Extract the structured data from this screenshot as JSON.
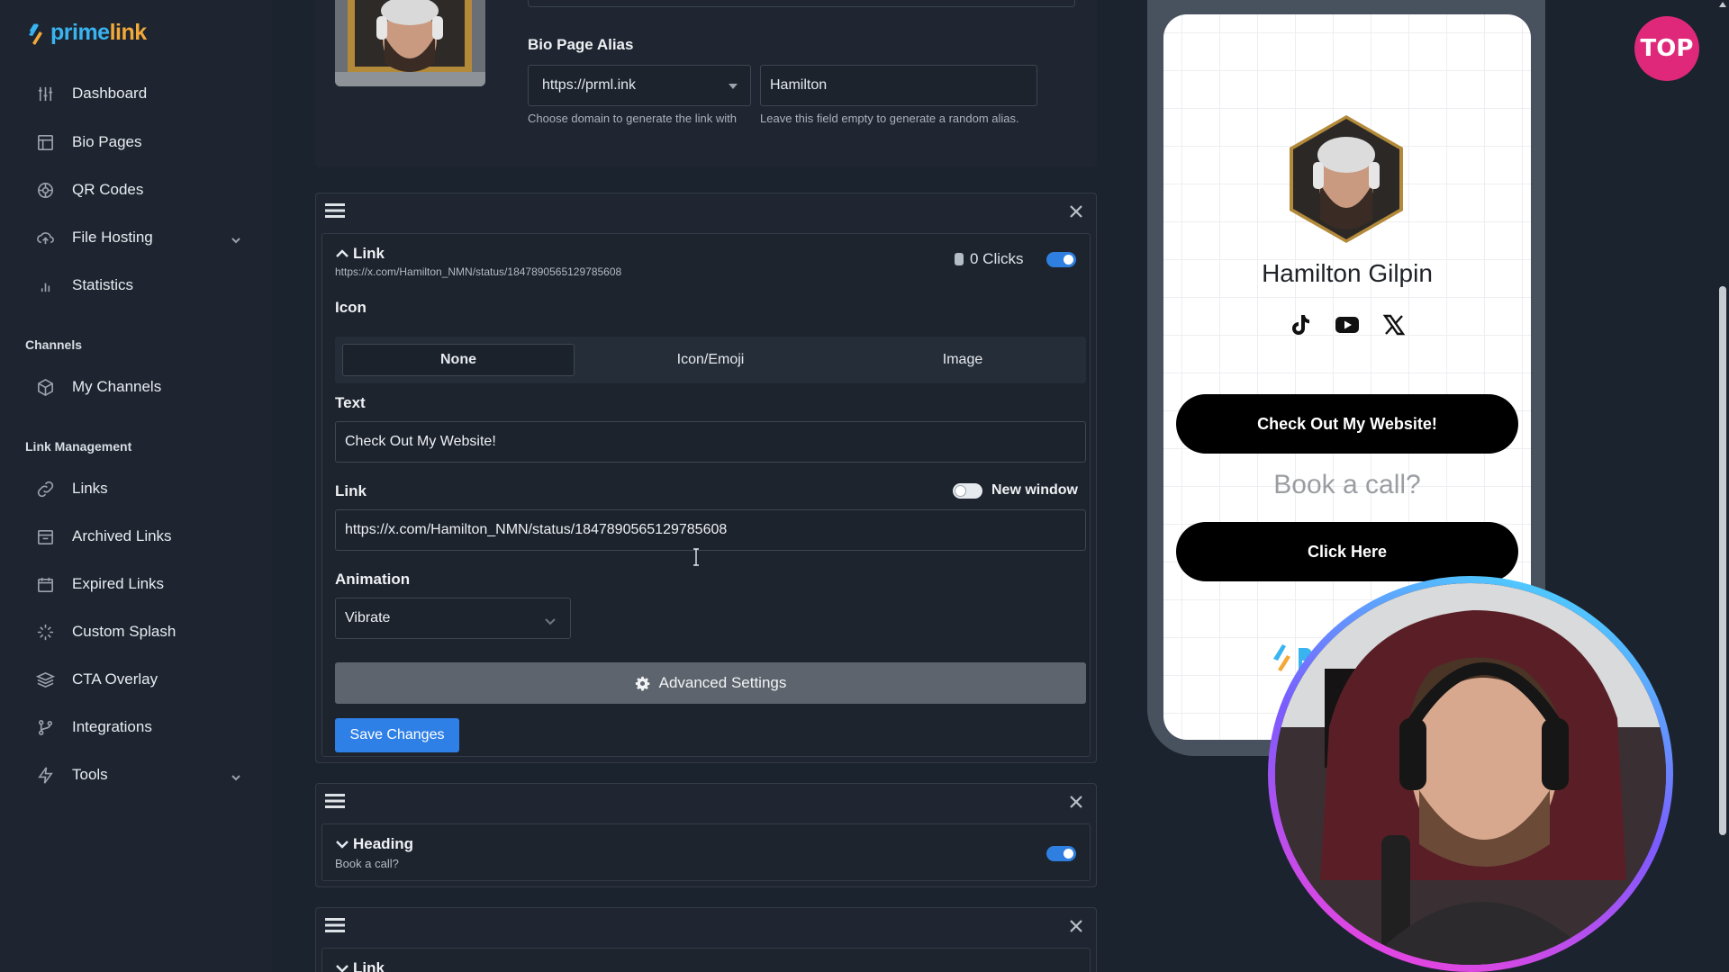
{
  "brand": {
    "part1": "prime",
    "part2": "link"
  },
  "sidebar": {
    "items": [
      {
        "label": "Dashboard",
        "icon": "dashboard-icon"
      },
      {
        "label": "Bio Pages",
        "icon": "bio-pages-icon"
      },
      {
        "label": "QR Codes",
        "icon": "qr-codes-icon"
      },
      {
        "label": "File Hosting",
        "icon": "file-hosting-icon"
      },
      {
        "label": "Statistics",
        "icon": "statistics-icon"
      }
    ],
    "channels_label": "Channels",
    "channels": [
      {
        "label": "My Channels",
        "icon": "cube-icon"
      }
    ],
    "link_mgmt_label": "Link Management",
    "link_mgmt": [
      {
        "label": "Links",
        "icon": "link-icon"
      },
      {
        "label": "Archived Links",
        "icon": "archive-icon"
      },
      {
        "label": "Expired Links",
        "icon": "calendar-icon"
      },
      {
        "label": "Custom Splash",
        "icon": "splash-icon"
      },
      {
        "label": "CTA Overlay",
        "icon": "layers-icon"
      },
      {
        "label": "Integrations",
        "icon": "integrations-icon"
      },
      {
        "label": "Tools",
        "icon": "bolt-icon"
      }
    ]
  },
  "alias": {
    "label": "Bio Page Alias",
    "domain_value": "https://prml.ink",
    "domain_hint": "Choose domain to generate the link with",
    "alias_value": "Hamilton",
    "alias_hint": "Leave this field empty to generate a random alias."
  },
  "link_block": {
    "title": "Link",
    "url": "https://x.com/Hamilton_NMN/status/1847890565129785608",
    "clicks": "0 Clicks",
    "enabled": true,
    "icon_label": "Icon",
    "icon_options": [
      "None",
      "Icon/Emoji",
      "Image"
    ],
    "icon_selected": "None",
    "text_label": "Text",
    "text_value": "Check Out My Website!",
    "link_label": "Link",
    "new_window_label": "New window",
    "new_window": false,
    "link_value": "https://x.com/Hamilton_NMN/status/1847890565129785608",
    "animation_label": "Animation",
    "animation_value": "Vibrate",
    "advanced_label": "Advanced Settings",
    "save_label": "Save Changes"
  },
  "heading_block": {
    "title": "Heading",
    "subtitle": "Book a call?",
    "enabled": true
  },
  "link_block_2": {
    "title": "Link"
  },
  "preview": {
    "name": "Hamilton Gilpin",
    "socials": [
      "tiktok-icon",
      "youtube-icon",
      "x-icon"
    ],
    "button1": "Check Out My Website!",
    "heading": "Book a call?",
    "button2": "Click Here"
  },
  "badge": "TOP",
  "colors": {
    "accent": "#2f80e6",
    "sidebar_bg": "#1e2530",
    "page_bg": "#1b232e",
    "preview_button": "#000000"
  }
}
